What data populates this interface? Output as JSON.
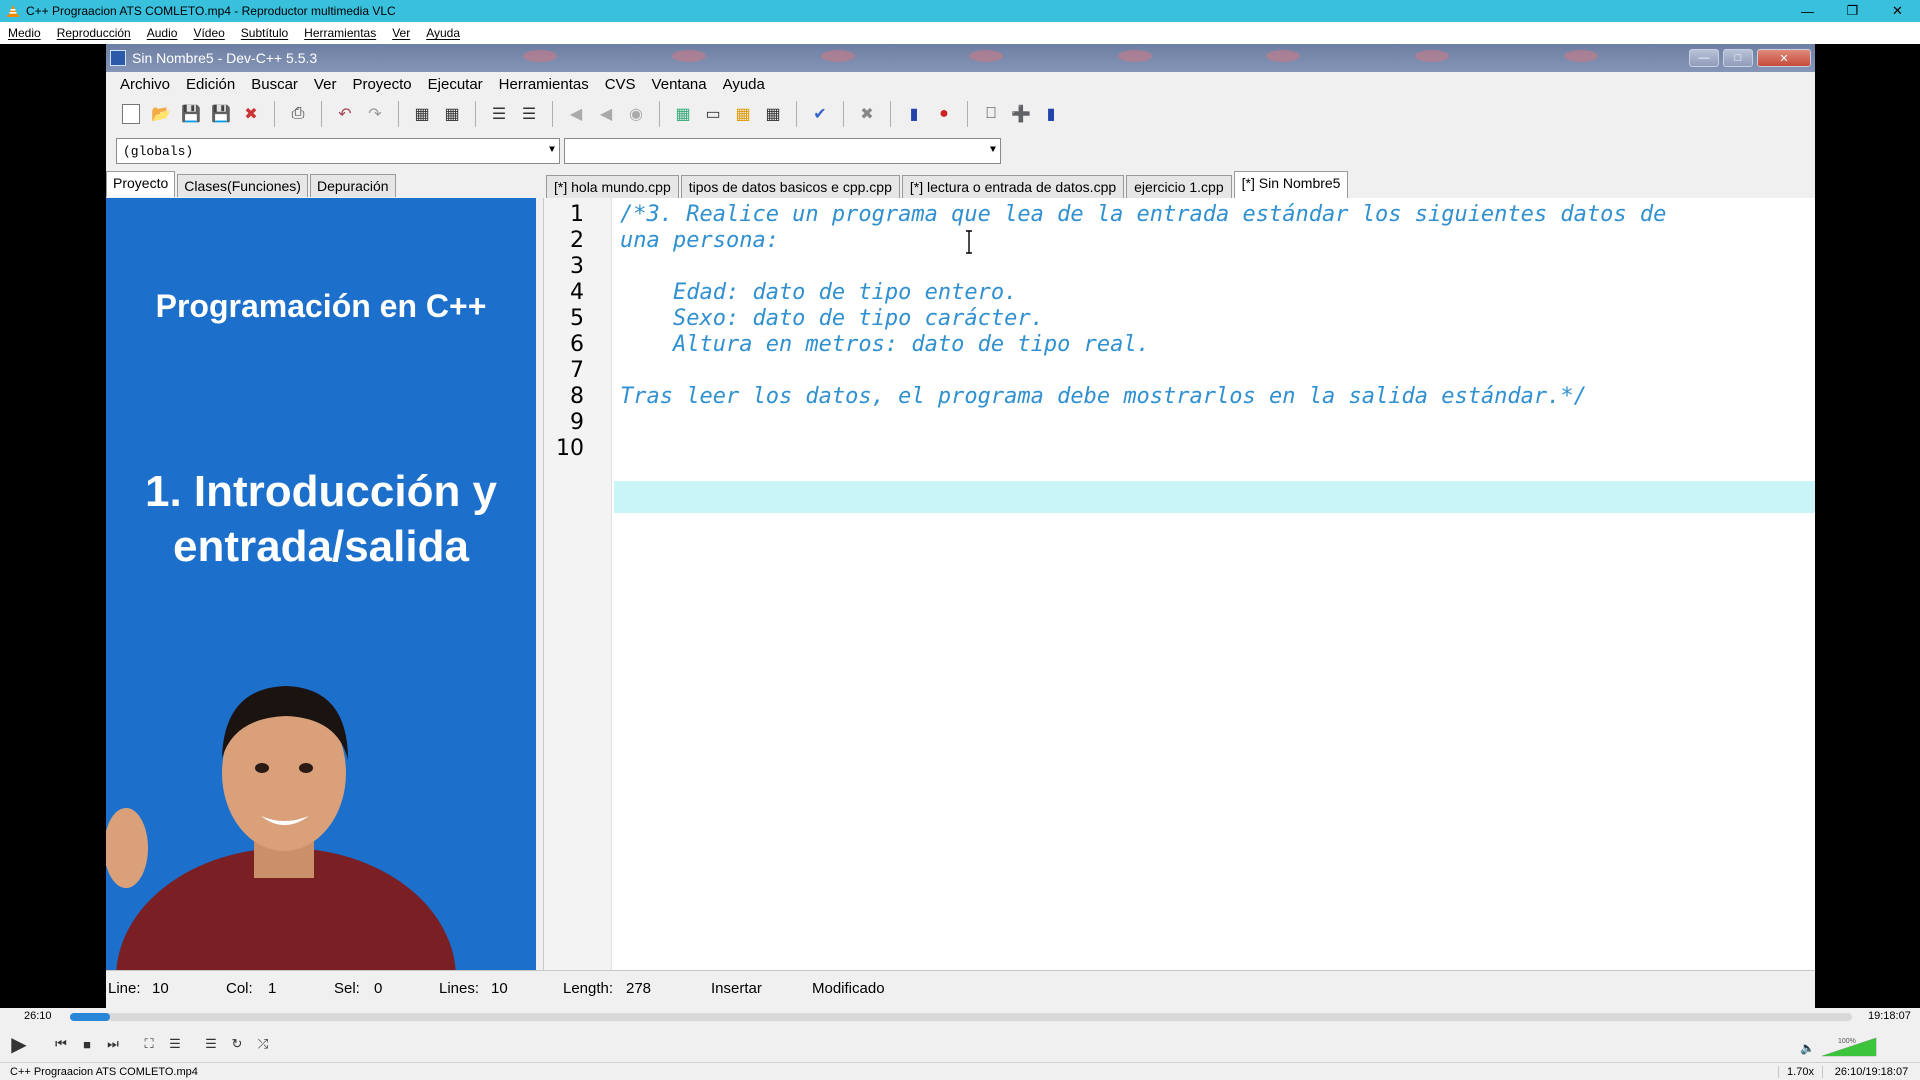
{
  "vlc": {
    "title": "C++ Prograacion ATS COMLETO.mp4 - Reproductor multimedia VLC",
    "menu": [
      "Medio",
      "Reproducción",
      "Audio",
      "Vídeo",
      "Subtítulo",
      "Herramientas",
      "Ver",
      "Ayuda"
    ],
    "elapsed": "26:10",
    "total": "19:18:07",
    "progress": 0.0226,
    "volume_label": "100%",
    "volume_level": 1.0,
    "status_filename": "C++ Prograacion ATS COMLETO.mp4",
    "rate": "1.70x",
    "status_time": "26:10/19:18:07"
  },
  "devcpp": {
    "title": "Sin Nombre5 - Dev-C++ 5.5.3",
    "menu": [
      "Archivo",
      "Edición",
      "Buscar",
      "Ver",
      "Proyecto",
      "Ejecutar",
      "Herramientas",
      "CVS",
      "Ventana",
      "Ayuda"
    ],
    "combo_scope": "(globals)",
    "combo_member": "",
    "left_tabs": [
      "Proyecto",
      "Clases(Funciones)",
      "Depuración"
    ],
    "editor_tabs": [
      "[*] hola mundo.cpp",
      "tipos de datos basicos e cpp.cpp",
      "[*] lectura o entrada de datos.cpp",
      "ejercicio 1.cpp",
      "[*] Sin Nombre5"
    ],
    "sidebar_title": "Programación en C++",
    "sidebar_sub_1": "1. Introducción y",
    "sidebar_sub_2": "entrada/salida",
    "code_lines": [
      {
        "n": "1",
        "text": "/*3. Realice un programa que lea de la entrada estándar los siguientes datos de"
      },
      {
        "n": "2",
        "text": "una persona:"
      },
      {
        "n": "3",
        "text": ""
      },
      {
        "n": "4",
        "text": "    Edad: dato de tipo entero."
      },
      {
        "n": "5",
        "text": "    Sexo: dato de tipo carácter."
      },
      {
        "n": "6",
        "text": "    Altura en metros: dato de tipo real."
      },
      {
        "n": "7",
        "text": ""
      },
      {
        "n": "8",
        "text": "Tras leer los datos, el programa debe mostrarlos en la salida estándar.*/"
      },
      {
        "n": "9",
        "text": ""
      },
      {
        "n": "10",
        "text": ""
      }
    ],
    "status": {
      "line_label": "Line:",
      "line_val": "10",
      "col_label": "Col:",
      "col_val": "1",
      "sel_label": "Sel:",
      "sel_val": "0",
      "lines_label": "Lines:",
      "lines_val": "10",
      "length_label": "Length:",
      "length_val": "278",
      "mode": "Insertar",
      "state": "Modificado"
    },
    "colors": {
      "sidebar": "#1c6fcb",
      "code": "#3090d0",
      "current_line": "#c9f5f8"
    }
  }
}
